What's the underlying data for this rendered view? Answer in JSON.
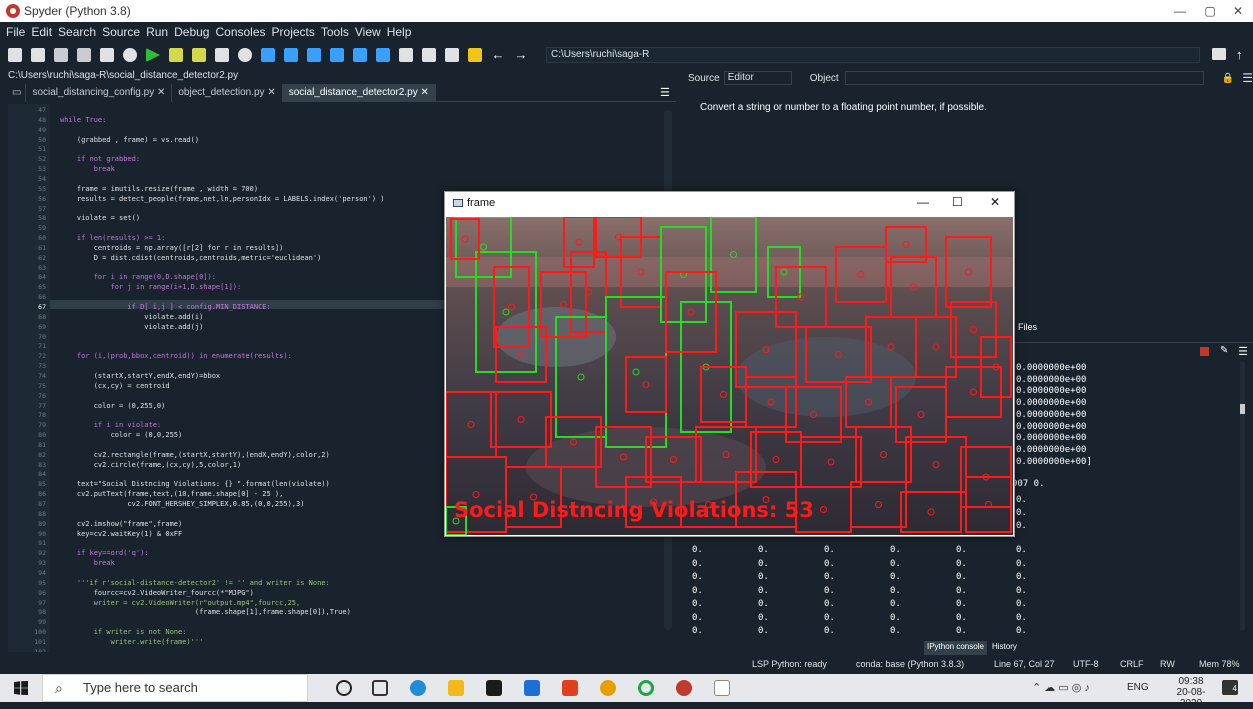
{
  "window": {
    "title": "Spyder (Python 3.8)",
    "minimize": "—",
    "maximize": "▢",
    "close": "✕"
  },
  "menu": [
    "File",
    "Edit",
    "Search",
    "Source",
    "Run",
    "Debug",
    "Consoles",
    "Projects",
    "Tools",
    "View",
    "Help"
  ],
  "toolbar": {
    "path": "C:\\Users\\ruchi\\saga-R"
  },
  "editor": {
    "file_path": "C:\\Users\\ruchi\\saga-R\\social_distance_detector2.py",
    "tabs": [
      "social_distancing_config.py",
      "object_detection.py",
      "social_distance_detector2.py"
    ],
    "lines": [
      {
        "n": "47",
        "t": ""
      },
      {
        "n": "48",
        "t": "while True:"
      },
      {
        "n": "49",
        "t": ""
      },
      {
        "n": "50",
        "t": "    (grabbed , frame) = vs.read()"
      },
      {
        "n": "51",
        "t": ""
      },
      {
        "n": "52",
        "t": "    if not grabbed:"
      },
      {
        "n": "53",
        "t": "        break"
      },
      {
        "n": "54",
        "t": ""
      },
      {
        "n": "55",
        "t": "    frame = imutils.resize(frame , width = 700)"
      },
      {
        "n": "56",
        "t": "    results = detect_people(frame,net,ln,personIdx = LABELS.index('person') )"
      },
      {
        "n": "57",
        "t": ""
      },
      {
        "n": "58",
        "t": "    violate = set()"
      },
      {
        "n": "59",
        "t": ""
      },
      {
        "n": "60",
        "t": "    if len(results) >= 1:"
      },
      {
        "n": "61",
        "t": "        centroids = np.array([r[2] for r in results])"
      },
      {
        "n": "62",
        "t": "        D = dist.cdist(centroids,centroids,metric='euclidean')"
      },
      {
        "n": "63",
        "t": ""
      },
      {
        "n": "64",
        "t": "        for i in range(0,D.shape[0]):"
      },
      {
        "n": "65",
        "t": "            for j in range(i+1,D.shape[1]):"
      },
      {
        "n": "66",
        "t": ""
      },
      {
        "n": "67",
        "t": "                if D[ i,j ] < config.MIN_DISTANCE:"
      },
      {
        "n": "68",
        "t": "                    violate.add(i)"
      },
      {
        "n": "69",
        "t": "                    violate.add(j)"
      },
      {
        "n": "70",
        "t": ""
      },
      {
        "n": "71",
        "t": ""
      },
      {
        "n": "72",
        "t": "    for (i,(prob,bbox,centroid)) in enumerate(results):"
      },
      {
        "n": "73",
        "t": ""
      },
      {
        "n": "74",
        "t": "        (startX,startY,endX,endY)=bbox"
      },
      {
        "n": "75",
        "t": "        (cx,cy) = centroid"
      },
      {
        "n": "76",
        "t": ""
      },
      {
        "n": "77",
        "t": "        color = (0,255,0)"
      },
      {
        "n": "78",
        "t": ""
      },
      {
        "n": "79",
        "t": "        if i in violate:"
      },
      {
        "n": "80",
        "t": "            color = (0,0,255)"
      },
      {
        "n": "81",
        "t": ""
      },
      {
        "n": "82",
        "t": "        cv2.rectangle(frame,(startX,startY),(endX,endY),color,2)"
      },
      {
        "n": "83",
        "t": "        cv2.circle(frame,(cx,cy),5,color,1)"
      },
      {
        "n": "84",
        "t": ""
      },
      {
        "n": "85",
        "t": "    text=\"Social Distncing Violations: {} \".format(len(violate))"
      },
      {
        "n": "86",
        "t": "    cv2.putText(frame,text,(10,frame.shape[0] - 25 ),"
      },
      {
        "n": "87",
        "t": "                cv2.FONT_HERSHEY_SIMPLEX,0.85,(0,0,255),3)"
      },
      {
        "n": "88",
        "t": ""
      },
      {
        "n": "89",
        "t": "    cv2.imshow(\"frame\",frame)"
      },
      {
        "n": "90",
        "t": "    key=cv2.waitKey(1) & 0xFF"
      },
      {
        "n": "91",
        "t": ""
      },
      {
        "n": "92",
        "t": "    if key==ord('q'):"
      },
      {
        "n": "93",
        "t": "        break"
      },
      {
        "n": "94",
        "t": ""
      },
      {
        "n": "95",
        "t": "    '''if r'social-distance-detector2' != '' and writer is None:"
      },
      {
        "n": "96",
        "t": "        fourcc=cv2.VideoWriter_fourcc(*\"MJPG\")"
      },
      {
        "n": "97",
        "t": "        writer = cv2.VideoWriter(r\"output.mp4\",fourcc,25,"
      },
      {
        "n": "98",
        "t": "                                (frame.shape[1],frame.shape[0]),True)"
      },
      {
        "n": "99",
        "t": ""
      },
      {
        "n": "100",
        "t": "        if writer is not None:"
      },
      {
        "n": "101",
        "t": "            writer.write(frame)'''"
      },
      {
        "n": "102",
        "t": ""
      }
    ]
  },
  "help": {
    "source_label": "Source",
    "source_value": "Editor",
    "object_label": "Object",
    "text": "Convert a string or number to a floating point number, if possible.",
    "files_tab": "Files"
  },
  "console": {
    "sci_lines": [
      "0.0000000e+00",
      "0.0000000e+00",
      "0.0000000e+00",
      "0.0000000e+00",
      "0.0000000e+00",
      "0.0000000e+00",
      "0.0000000e+00",
      "0.0000000e+00",
      "0.0000000e+00]"
    ],
    "line_907": "907 0.",
    "zero": "0.",
    "tabs": [
      "IPython console",
      "History"
    ]
  },
  "frame_window": {
    "title": "frame",
    "overlay_text": "Social Distncing Violations: 53"
  },
  "status": {
    "lsp": "LSP Python: ready",
    "conda": "conda: base (Python 3.8.3)",
    "position": "Line 67, Col 27",
    "encoding": "UTF-8",
    "eol": "CRLF",
    "rw": "RW",
    "mem": "Mem 78%"
  },
  "taskbar": {
    "search_placeholder": "Type here to search",
    "lang": "ENG",
    "time": "09:38",
    "date": "20-08-2020",
    "notifications": "4"
  },
  "colors": {
    "violation": "#ff1a1a",
    "safe": "#22dd22",
    "bg": "#19232d"
  }
}
